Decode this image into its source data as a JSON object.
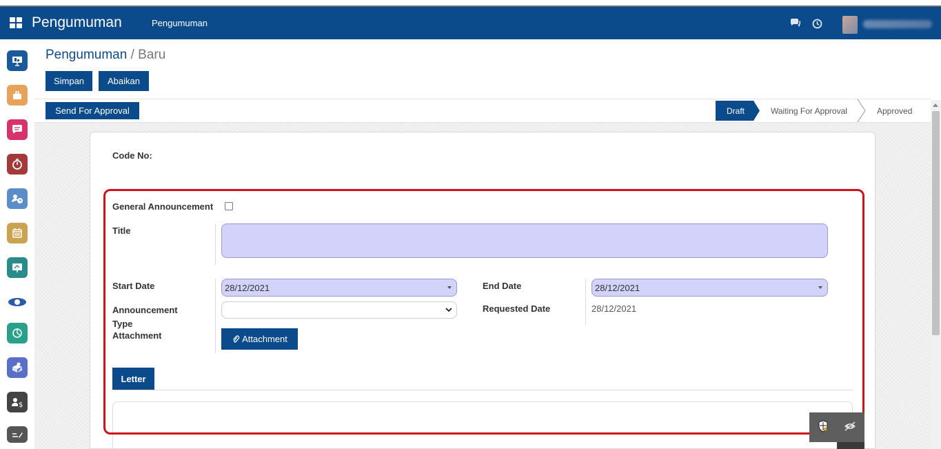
{
  "navbar": {
    "brand": "Pengumuman",
    "menu": "Pengumuman"
  },
  "breadcrumb": {
    "main": "Pengumuman",
    "separator": " / ",
    "current": "Baru"
  },
  "actions": {
    "save": "Simpan",
    "discard": "Abaikan",
    "send_for_approval": "Send For Approval"
  },
  "stages": {
    "draft": "Draft",
    "waiting": "Waiting For Approval",
    "approved": "Approved"
  },
  "form": {
    "code_no_label": "Code No:",
    "general_announcement_label": "General Announcement",
    "title_label": "Title",
    "title_value": "",
    "start_date_label": "Start Date",
    "start_date_value": "28/12/2021",
    "end_date_label": "End Date",
    "end_date_value": "28/12/2021",
    "announcement_type_label_line1": "Announcement",
    "announcement_type_label_line2": "Type",
    "requested_date_label": "Requested Date",
    "requested_date_value": "28/12/2021",
    "attachment_label": "Attachment",
    "attachment_button": "Attachment"
  },
  "tabs": {
    "letter": "Letter"
  },
  "colors": {
    "primary": "#0b4a8b",
    "input_highlight": "#d2d2fb",
    "annotation_red": "#d0121b"
  },
  "icons": [
    "apps-grid-icon",
    "chat-icon",
    "clock-icon",
    "paperclip-icon",
    "shield-icon",
    "eye-off-icon"
  ]
}
